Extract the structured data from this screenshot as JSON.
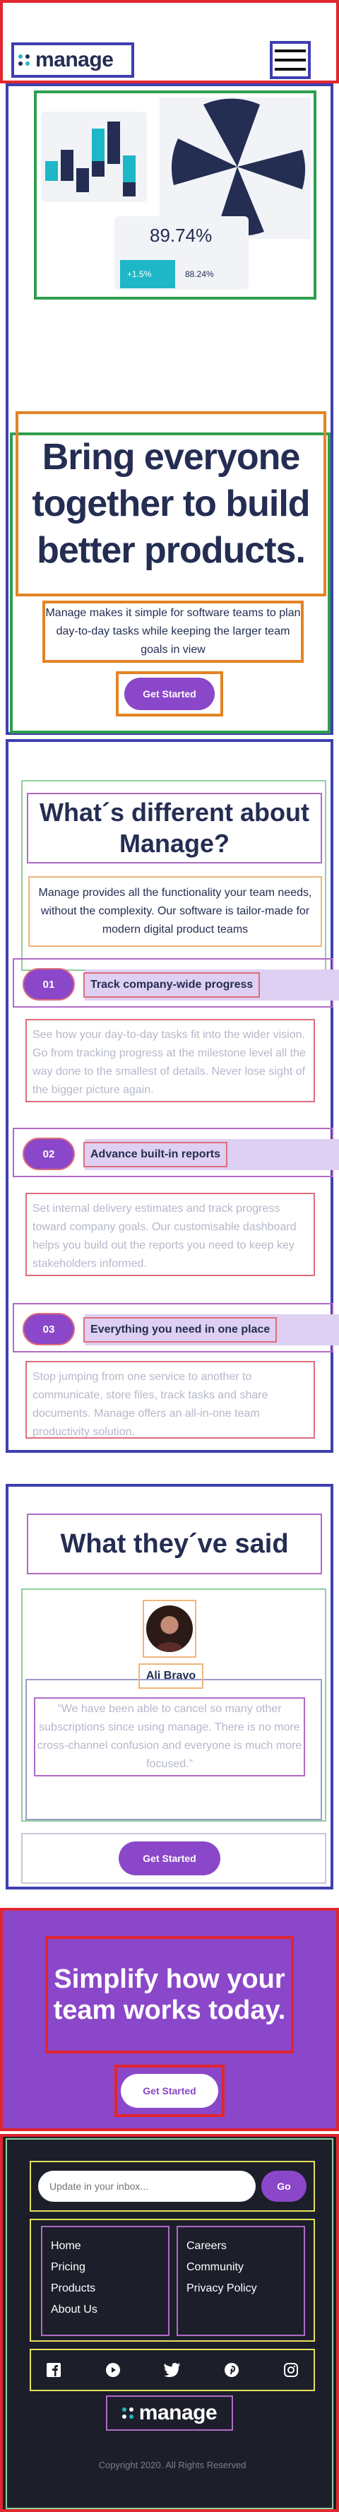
{
  "header": {
    "logo_text": "manage",
    "menu_icon": "hamburger-icon"
  },
  "hero": {
    "dashboard": {
      "percent": "89.74%",
      "change": "+1.5%",
      "secondary": "88.24%"
    },
    "title": "Bring everyone together to build better products.",
    "description": "Manage makes it simple for software teams to plan day-to-day tasks while keeping the larger team goals in view",
    "cta": "Get Started"
  },
  "features": {
    "title": "What´s different about Manage?",
    "description": "Manage provides all the functionality your team needs, without the complexity. Our software is tailor-made for modern digital product teams",
    "items": [
      {
        "num": "01",
        "title": "Track company-wide progress",
        "body": "See how your day-to-day tasks fit into the wider vision. Go from tracking progress at the milestone level all the way done to the smallest of details. Never lose sight of the bigger picture again."
      },
      {
        "num": "02",
        "title": "Advance built-in reports",
        "body": "Set internal delivery estimates and track progress toward company goals. Our customisable dashboard helps you build out the reports you need to keep key stakeholders informed."
      },
      {
        "num": "03",
        "title": "Everything you need in one place",
        "body": "Stop jumping from one service to another to communicate, store files, track tasks and share documents. Manage offers an all-in-one team productivity solution."
      }
    ]
  },
  "testimonials": {
    "title": "What they´ve said",
    "name": "Ali Bravo",
    "quote": "“We have been able to cancel so many other subscriptions since using manage. There is no more cross-channel confusion and everyone is much more focused.”",
    "cta": "Get Started"
  },
  "cta_band": {
    "title": "Simplify how your team works today.",
    "cta": "Get Started"
  },
  "footer": {
    "email_placeholder": "Update in your inbox...",
    "go_label": "Go",
    "links_left": [
      "Home",
      "Pricing",
      "Products",
      "About Us"
    ],
    "links_right": [
      "Careers",
      "Community",
      "Privacy Policy"
    ],
    "socials": [
      "facebook-icon",
      "youtube-icon",
      "twitter-icon",
      "pinterest-icon",
      "instagram-icon"
    ],
    "logo_text": "manage",
    "copyright": "Copyright 2020. All Rights Reserved"
  },
  "colors": {
    "brand_purple": "#8b47c9",
    "navy": "#242d52",
    "teal": "#1eb7c7",
    "footer_bg": "#1c1e2a"
  }
}
